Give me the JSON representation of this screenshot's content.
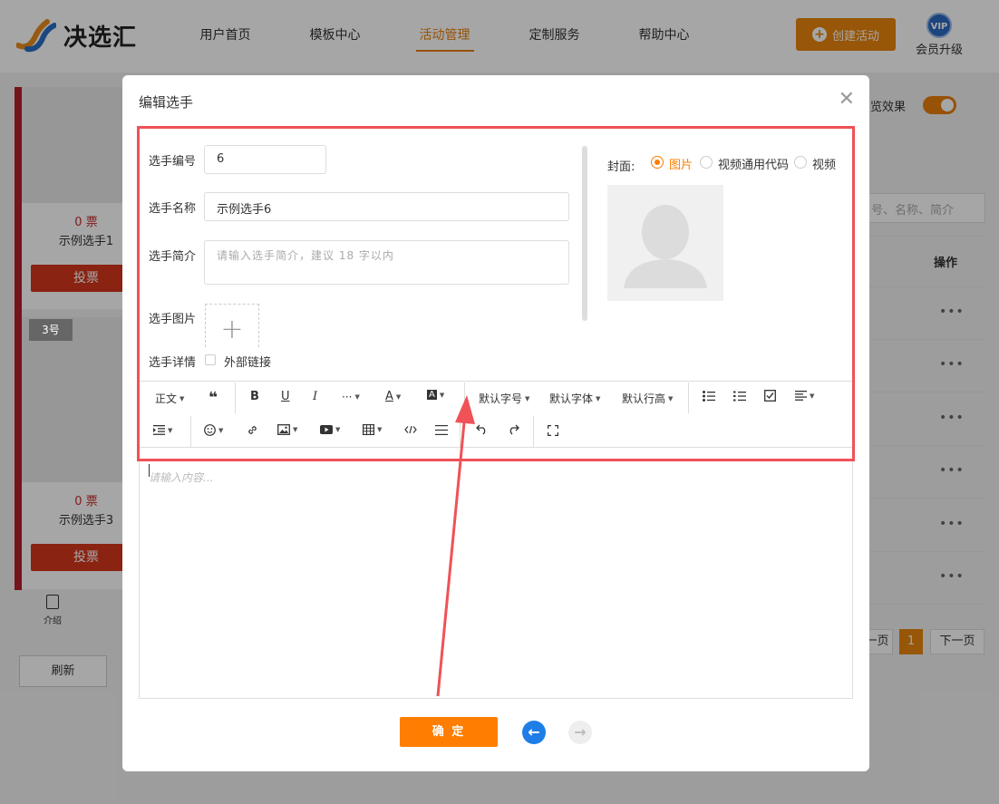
{
  "header": {
    "logo_text": "决选汇",
    "nav": [
      "用户首页",
      "模板中心",
      "活动管理",
      "定制服务",
      "帮助中心"
    ],
    "active_nav": 2,
    "create_button": "创建活动",
    "vip_badge": "VIP",
    "vip_label": "会员升级"
  },
  "background": {
    "cards": [
      {
        "votes": "0 票",
        "name": "示例选手1",
        "vote_button": "投票"
      },
      {
        "votes": "0 票",
        "name": "示例选手3",
        "vote_button": "投票"
      }
    ],
    "badge_3": "3号",
    "intro_label": "介绍",
    "refresh_button": "刷新",
    "preview_label": "览效果",
    "search_placeholder": "号、名称、简介",
    "column_header": "操作",
    "row_more": "•••",
    "pager": {
      "prev": "一页",
      "current": "1",
      "next": "下一页"
    }
  },
  "modal": {
    "title": "编辑选手",
    "close_icon": "close-icon",
    "fields": {
      "number_label": "选手编号",
      "number_value": "6",
      "name_label": "选手名称",
      "name_value": "示例选手6",
      "intro_label": "选手简介",
      "intro_placeholder": "请输入选手简介，建议 18 字以内",
      "image_label": "选手图片",
      "upload_plus": "+",
      "detail_label": "选手详情",
      "external_link_label": "外部链接"
    },
    "cover": {
      "label": "封面:",
      "options": [
        "图片",
        "视频通用代码",
        "视频"
      ],
      "selected": 0
    },
    "toolbar": {
      "paragraph": "正文",
      "quote": "❝",
      "bold": "B",
      "underline": "U",
      "italic": "I",
      "more": "···",
      "font_color": "A",
      "bg_color": "A",
      "font_size": "默认字号",
      "font_family": "默认字体",
      "line_height": "默认行高",
      "caret": "▼"
    },
    "editor_placeholder": "请输入内容...",
    "confirm_button": "确 定",
    "prev_icon": "←",
    "next_icon": "→"
  },
  "colors": {
    "accent": "#ff7d00",
    "highlight": "#ef5257",
    "vote_red": "#d5371d",
    "nav_blue": "#1e7ee8"
  }
}
